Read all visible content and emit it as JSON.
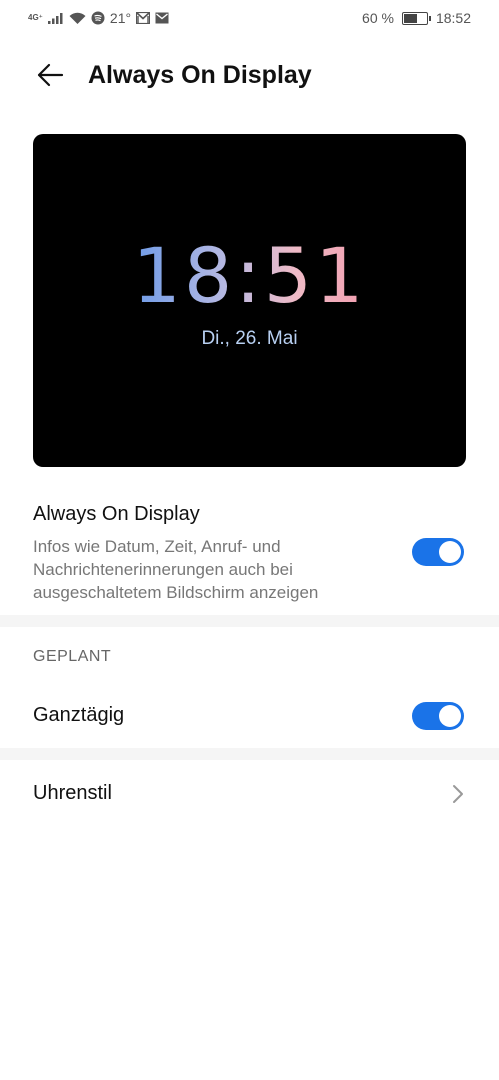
{
  "status_bar": {
    "network": "4G⁺",
    "temperature": "21°",
    "battery_percent": "60 %",
    "battery_level": 0.6,
    "time": "18:52",
    "icons": [
      "signal-icon",
      "wifi-icon",
      "spotify-icon",
      "gmail-icon",
      "mail-icon",
      "battery-icon"
    ]
  },
  "header": {
    "title": "Always On Display"
  },
  "preview": {
    "time": "18:51",
    "date": "Di., 26. Mai"
  },
  "settings": {
    "aod": {
      "title": "Always On Display",
      "description": "Infos wie Datum, Zeit, Anruf- und Nachrichtenerinnerungen auch bei ausgeschaltetem Bildschirm anzeigen",
      "enabled": true
    },
    "section_label": "GEPLANT",
    "all_day": {
      "title": "Ganztägig",
      "enabled": true
    },
    "clock_style": {
      "title": "Uhrenstil"
    }
  },
  "colors": {
    "accent": "#1a73e8",
    "separator": "#f5f5f5"
  }
}
